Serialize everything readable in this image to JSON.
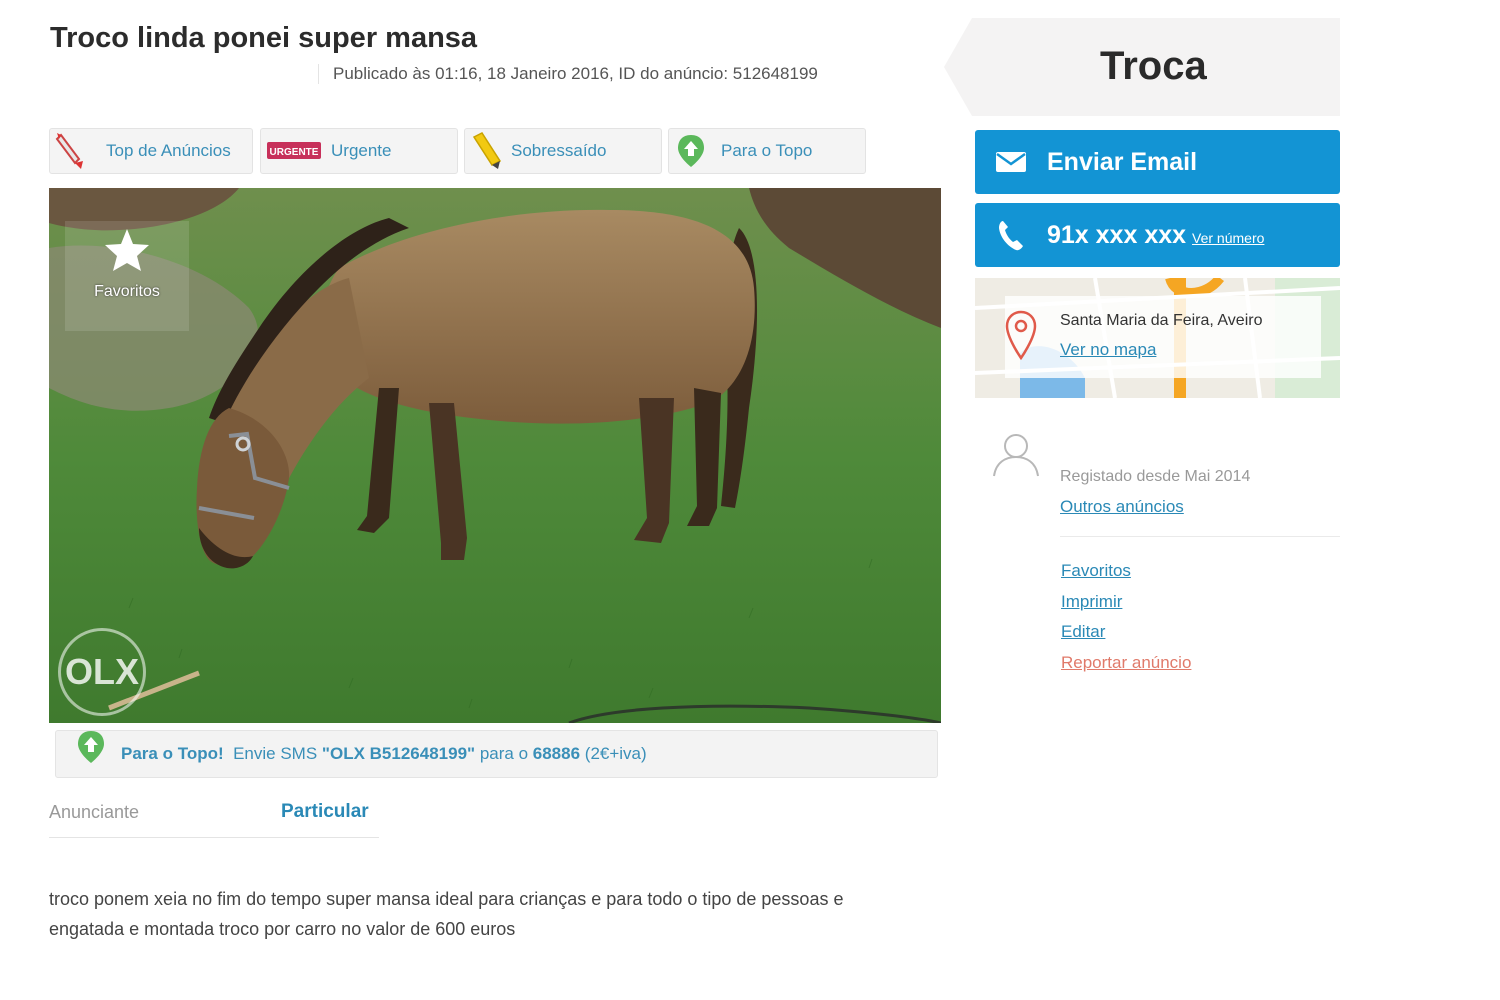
{
  "ad": {
    "title": "Troco linda ponei super mansa",
    "meta": "Publicado às 01:16, 18 Janeiro 2016, ID do anúncio: 512648199"
  },
  "promos": [
    {
      "label": "Top de Anúncios",
      "icon": "rocket-icon"
    },
    {
      "label": "Urgente",
      "icon": "urgente-tag-icon",
      "tag": "URGENTE"
    },
    {
      "label": "Sobressaído",
      "icon": "highlighter-pen-icon"
    },
    {
      "label": "Para o Topo",
      "icon": "up-arrow-badge-icon"
    }
  ],
  "photo": {
    "favorite_label": "Favoritos",
    "watermark": "OLX"
  },
  "sms": {
    "lead": "Para o Topo!",
    "text1": "Envie SMS",
    "code": "\"OLX B512648199\"",
    "text2": "para o",
    "number": "68886",
    "price": "(2€+iva)"
  },
  "advertiser": {
    "key": "Anunciante",
    "value": "Particular"
  },
  "description": "troco ponem xeia no fim do tempo super mansa ideal para crianças e para todo o tipo de pessoas e engatada e montada troco por carro no valor de 600 euros",
  "sidebar": {
    "price_label": "Troca",
    "email_button": "Enviar Email",
    "phone_number": "91x xxx xxx",
    "phone_reveal": "Ver número",
    "location": "Santa Maria da Feira, Aveiro",
    "map_link": "Ver no mapa",
    "registered": "Registado desde Mai 2014",
    "other_ads": "Outros anúncios",
    "actions": {
      "favorites": "Favoritos",
      "print": "Imprimir",
      "edit": "Editar",
      "report": "Reportar anúncio"
    }
  },
  "colors": {
    "accent_blue": "#1394d4",
    "link_blue": "#2a89b6",
    "report_red": "#e07a6a"
  }
}
